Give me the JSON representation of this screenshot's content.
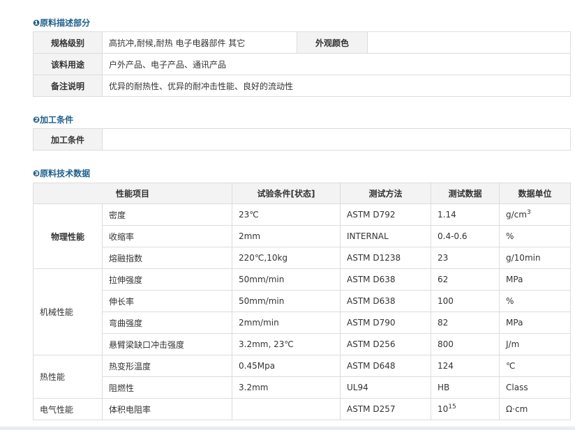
{
  "sections": {
    "s1": "❶原料描述部分",
    "s2": "❷加工条件",
    "s3": "❸原料技术数据"
  },
  "desc": {
    "grade_label": "规格级别",
    "grade_value": "高抗冲,耐候,耐热 电子电器部件 其它",
    "color_label": "外观颜色",
    "color_value": "",
    "use_label": "该料用途",
    "use_value": "户外产品、电子产品、通讯产品",
    "note_label": "备注说明",
    "note_value": "优异的耐热性、优异的耐冲击性能、良好的流动性"
  },
  "processing": {
    "label": "加工条件",
    "value": ""
  },
  "tech": {
    "headers": [
      "性能项目",
      "试验条件[状态]",
      "测试方法",
      "测试数据",
      "数据单位"
    ],
    "categories": [
      "物理性能",
      "机械性能",
      "热性能",
      "电气性能"
    ],
    "rows": [
      {
        "prop": "密度",
        "cond": "23℃",
        "method": "ASTM D792",
        "data": "1.14",
        "unit": "g/cm",
        "unit_sup": "3"
      },
      {
        "prop": "收缩率",
        "cond": "2mm",
        "method": "INTERNAL",
        "data": "0.4-0.6",
        "unit": "%"
      },
      {
        "prop": "熔融指数",
        "cond": "220℃,10kg",
        "method": "ASTM D1238",
        "data": "23",
        "unit": "g/10min"
      },
      {
        "prop": "拉伸强度",
        "cond": "50mm/min",
        "method": "ASTM D638",
        "data": "62",
        "unit": "MPa"
      },
      {
        "prop": "伸长率",
        "cond": "50mm/min",
        "method": "ASTM D638",
        "data": "100",
        "unit": "%"
      },
      {
        "prop": "弯曲强度",
        "cond": "2mm/min",
        "method": "ASTM D790",
        "data": "82",
        "unit": "MPa"
      },
      {
        "prop": "悬臂梁缺口冲击强度",
        "cond": "3.2mm, 23℃",
        "method": "ASTM D256",
        "data": "800",
        "unit": "J/m"
      },
      {
        "prop": "热变形温度",
        "cond": "0.45Mpa",
        "method": "ASTM D648",
        "data": "124",
        "unit": "℃"
      },
      {
        "prop": "阻燃性",
        "cond": "3.2mm",
        "method": "UL94",
        "data": "HB",
        "unit": "Class"
      },
      {
        "prop": "体积电阻率",
        "cond": "",
        "method": "ASTM D257",
        "data": "10",
        "data_sup": "15",
        "unit": "Ω·cm"
      }
    ]
  }
}
